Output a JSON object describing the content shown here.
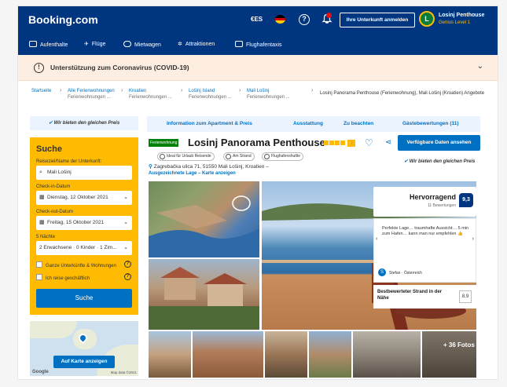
{
  "header": {
    "logo": "Booking.com",
    "currency": "€ES",
    "list_property": "Ihre Unterkunft anmelden",
    "user_name": "Losinj Penthouse",
    "user_level": "Genius Level 1",
    "user_initial": "L"
  },
  "nav": {
    "items": [
      {
        "label": "Aufenthalte",
        "icon": "bed-icon"
      },
      {
        "label": "Flüge",
        "icon": "plane-icon"
      },
      {
        "label": "Mietwagen",
        "icon": "car-icon"
      },
      {
        "label": "Attraktionen",
        "icon": "attractions-icon"
      },
      {
        "label": "Flughafentaxis",
        "icon": "taxi-icon"
      }
    ]
  },
  "covid": {
    "text": "Unterstützung zum Coronavirus (COVID-19)"
  },
  "breadcrumb": {
    "items": [
      {
        "label": "Startseite",
        "sub": ""
      },
      {
        "label": "Alle Ferienwohnungen",
        "sub": "Ferienwohnungen ..."
      },
      {
        "label": "Kroatien",
        "sub": "Ferienwohnungen ..."
      },
      {
        "label": "Lošinj Island",
        "sub": "Ferienwohnungen ..."
      },
      {
        "label": "Mali Lošinj",
        "sub": "Ferienwohnungen ..."
      }
    ],
    "current": "Losinj Panorama Penthouse (Ferienwohnung), Mali Lošinj (Kroatien) Angebote"
  },
  "sidebar": {
    "best_price": "Wir bieten den gleichen Preis",
    "search": {
      "title": "Suche",
      "destination_label": "Reiseziel/Name der Unterkunft:",
      "destination_value": "Mali Lošinj",
      "checkin_label": "Check-in-Datum",
      "checkin_value": "Dienstag, 12 Oktober 2021",
      "checkout_label": "Check-out-Datum",
      "checkout_value": "Freitag, 15 Oktober 2021",
      "guests_label": "5 Nächte",
      "guests_value": "2 Erwachsene · 0 Kinder · 1 Zim...",
      "option_1": "Ganze Unterkünfte & Wohnungen",
      "option_2": "Ich reise geschäftlich",
      "button": "Suche"
    },
    "map": {
      "button": "Auf Karte anzeigen",
      "google": "Google",
      "credit": "Map data ©2021"
    }
  },
  "tabs": {
    "items": [
      "Information zum Apartment & Preis",
      "Ausstattung",
      "Zu beachten",
      "Gästebewertungen (11)"
    ]
  },
  "property": {
    "type_badge": "Ferienwohnung",
    "name": "Losinj Panorama Penthouse",
    "stars": 4,
    "reserve_button": "Verfügbare Daten ansehen",
    "pills": [
      "Ideal für Urlaub Reisende",
      "Am Strand",
      "Flughafenshuttle"
    ],
    "best_price": "Wir bieten den gleichen Preis",
    "address": "Zagrebačka ulica 71, 51550 Mali Lošinj, Kroatien –",
    "location_link": "Ausgezeichnete Lage – Karte anzeigen"
  },
  "review": {
    "title": "Hervorragend",
    "count": "11 Bewertungen",
    "score": "9,3",
    "quote": "Perfekte Lage… traumhafte Aussicht… 5 min zum Hafen… kann man nur empfehlen 👍",
    "reviewer_initial": "S",
    "reviewer": "Stefan · Österreich",
    "beach_text": "Bestbewerteter Strand in der Nähe",
    "beach_score": "8,9"
  },
  "gallery": {
    "more_photos": "+ 36 Fotos"
  },
  "colors": {
    "brand_dark": "#003580",
    "brand_blue": "#0071c2",
    "genius_yellow": "#febb02"
  }
}
